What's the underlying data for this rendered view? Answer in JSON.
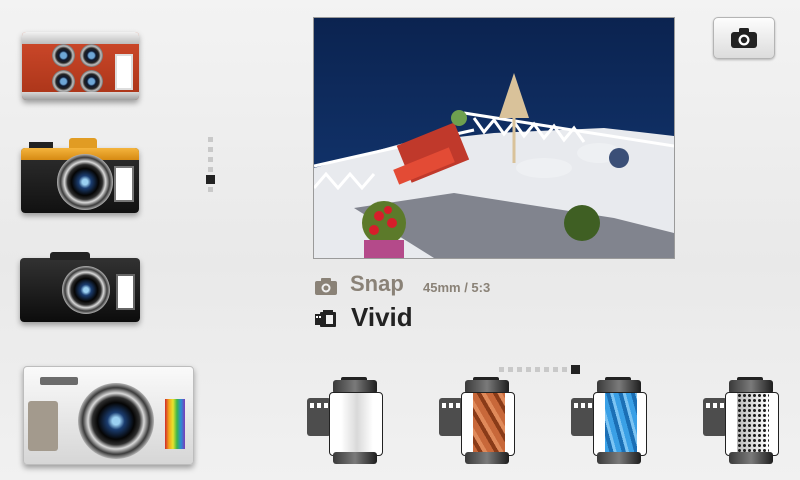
{
  "cameras": [
    {
      "name": "red-quad-lens-camera",
      "selected": false
    },
    {
      "name": "orange-instant-camera",
      "selected": false
    },
    {
      "name": "black-compact-camera",
      "selected": true
    },
    {
      "name": "silver-compact-camera",
      "selected": false
    }
  ],
  "camera_pager": {
    "count": 6,
    "active_index": 4
  },
  "preview": {
    "description_icon": "terrace-photo"
  },
  "shutter": {
    "icon": "camera-icon"
  },
  "lens": {
    "icon": "camera-icon",
    "name": "Snap",
    "spec": "45mm / 5:3"
  },
  "film": {
    "icon": "film-icon",
    "name": "Vivid"
  },
  "film_pager": {
    "count": 9,
    "active_index": 8
  },
  "films": [
    {
      "name": "white-film",
      "color": "#e9e9e9"
    },
    {
      "name": "copper-film",
      "color": "#b5562b"
    },
    {
      "name": "blue-film",
      "color": "#2c8ed6"
    },
    {
      "name": "mono-dots-film",
      "color": "#6a6a6a"
    }
  ],
  "colors": {
    "accent_text": "#8a8277",
    "primary_text": "#222222"
  }
}
